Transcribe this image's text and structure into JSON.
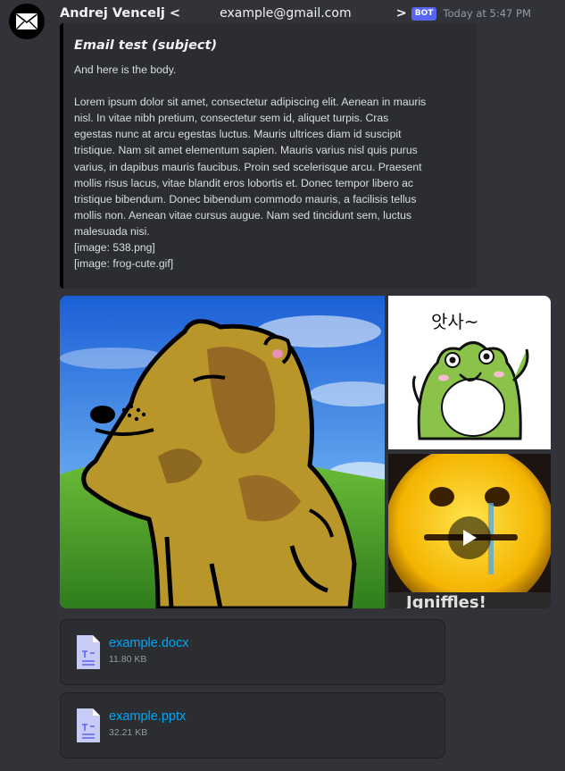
{
  "message": {
    "author": "Andrej Vencelj <",
    "author_email": "example@gmail.com",
    "author_suffix": ">",
    "badge": "BOT",
    "timestamp": "Today at 5:47 PM",
    "avatar_icon": "envelope-icon"
  },
  "embed": {
    "title": "Email test (subject)",
    "body": "And here is the body.\n\nLorem ipsum dolor sit amet, consectetur adipiscing elit. Aenean in mauris\nnisl. In vitae nibh pretium, consectetur sem id, aliquet turpis. Cras\negestas nunc at arcu egestas luctus. Mauris ultrices diam id suscipit\ntristique. Nam sit amet elementum sapien. Mauris varius nisl quis purus\nvarius, in dapibus mauris faucibus. Proin sed scelerisque arcu. Praesent\nmollis risus lacus, vitae blandit eros lobortis et. Donec tempor libero ac\ntristique bibendum. Donec bibendum commodo mauris, a facilisis tellus\nmollis non. Aenean vitae cursus augue. Nam sed tincidunt sem, luctus\nmalesuada nisi.\n[image: 538.png]\n[image: frog-cute.gif]",
    "border_color": "#000000"
  },
  "gallery": {
    "frog_text": "앗사~",
    "video_caption_text": "Jgniffles!"
  },
  "attachments": [
    {
      "name": "example.docx",
      "size": "11.80 KB",
      "icon": "text-file-icon"
    },
    {
      "name": "example.pptx",
      "size": "32.21 KB",
      "icon": "text-file-icon"
    }
  ],
  "colors": {
    "background": "#313338",
    "embed_bg": "#2b2d31",
    "link": "#00a8fc",
    "bot_badge": "#5865f2"
  }
}
